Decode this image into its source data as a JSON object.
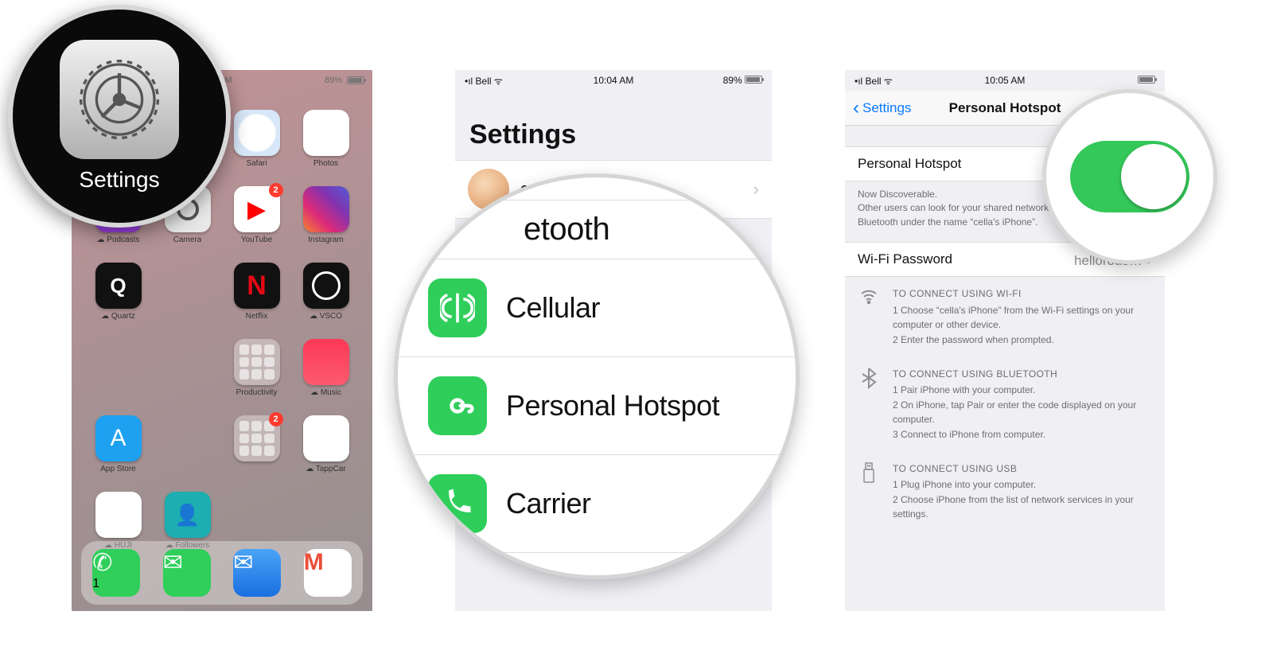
{
  "panel1": {
    "status": {
      "time": "4 AM",
      "battery": "89%"
    },
    "apps": [
      {
        "label": "Safari",
        "tile": "t-safari"
      },
      {
        "label": "Photos",
        "tile": "t-photos"
      },
      {
        "label": "Podcasts",
        "tile": "t-podcasts",
        "cloud": true
      },
      {
        "label": "Camera",
        "tile": "t-camera"
      },
      {
        "label": "YouTube",
        "tile": "t-youtube",
        "badge": "2"
      },
      {
        "label": "Instagram",
        "tile": "t-instagram"
      },
      {
        "label": "Quartz",
        "tile": "t-quartz",
        "cloud": true
      },
      {
        "label": "",
        "tile": ""
      },
      {
        "label": "Netflix",
        "tile": "t-netflix"
      },
      {
        "label": "VSCO",
        "tile": "t-vsco",
        "cloud": true
      },
      {
        "label": "",
        "tile": ""
      },
      {
        "label": "",
        "tile": ""
      },
      {
        "label": "Productivity",
        "tile": "t-folder"
      },
      {
        "label": "Music",
        "tile": "t-music",
        "cloud": true
      },
      {
        "label": "App Store",
        "tile": "t-appstore"
      },
      {
        "label": "",
        "tile": ""
      },
      {
        "label": "",
        "tile": "t-folder",
        "badge": "2"
      },
      {
        "label": "TappCar",
        "tile": "t-tappcar",
        "cloud": true
      },
      {
        "label": "HUJI",
        "tile": "t-huji",
        "cloud": true
      },
      {
        "label": "Followers",
        "tile": "t-followers",
        "cloud": true
      }
    ],
    "dock": [
      {
        "label": "Phone",
        "tile": "t-phone",
        "badge": "1"
      },
      {
        "label": "Messages",
        "tile": "t-messages"
      },
      {
        "label": "Mail",
        "tile": "t-mail"
      },
      {
        "label": "Gmail",
        "tile": "t-gmail"
      }
    ]
  },
  "callout1": {
    "label": "Settings"
  },
  "panel2": {
    "status": {
      "carrier": "Bell",
      "time": "10:04 AM",
      "battery": "89%"
    },
    "header": "Settings",
    "profile_name": "cella"
  },
  "callout2": {
    "rows": [
      {
        "label": "etooth",
        "icon": "bt-fragment"
      },
      {
        "label": "Cellular",
        "icon": "cellular"
      },
      {
        "label": "Personal Hotspot",
        "icon": "hotspot"
      },
      {
        "label": "Carrier",
        "icon": "phone"
      }
    ]
  },
  "panel3": {
    "status": {
      "carrier": "Bell",
      "time": "10:05 AM"
    },
    "nav": {
      "back": "Settings",
      "title": "Personal Hotspot"
    },
    "toggle_row": {
      "label": "Personal Hotspot",
      "on": true
    },
    "discover_line1": "Now Discoverable.",
    "discover_line2": "Other users can look for your shared network using Wi-Fi and Bluetooth under the name “cella's iPhone”.",
    "wifi_pass": {
      "label": "Wi-Fi Password",
      "value": "hellorous…"
    },
    "instructions": [
      {
        "icon": "wifi",
        "header": "TO CONNECT USING WI-FI",
        "lines": [
          "1 Choose “cella's iPhone” from the Wi-Fi settings on your computer or other device.",
          "2 Enter the password when prompted."
        ]
      },
      {
        "icon": "bluetooth",
        "header": "TO CONNECT USING BLUETOOTH",
        "lines": [
          "1 Pair iPhone with your computer.",
          "2 On iPhone, tap Pair or enter the code displayed on your computer.",
          "3 Connect to iPhone from computer."
        ]
      },
      {
        "icon": "usb",
        "header": "TO CONNECT USING USB",
        "lines": [
          "1 Plug iPhone into your computer.",
          "2 Choose iPhone from the list of network services in your settings."
        ]
      }
    ]
  },
  "callout3": {
    "on": true
  }
}
